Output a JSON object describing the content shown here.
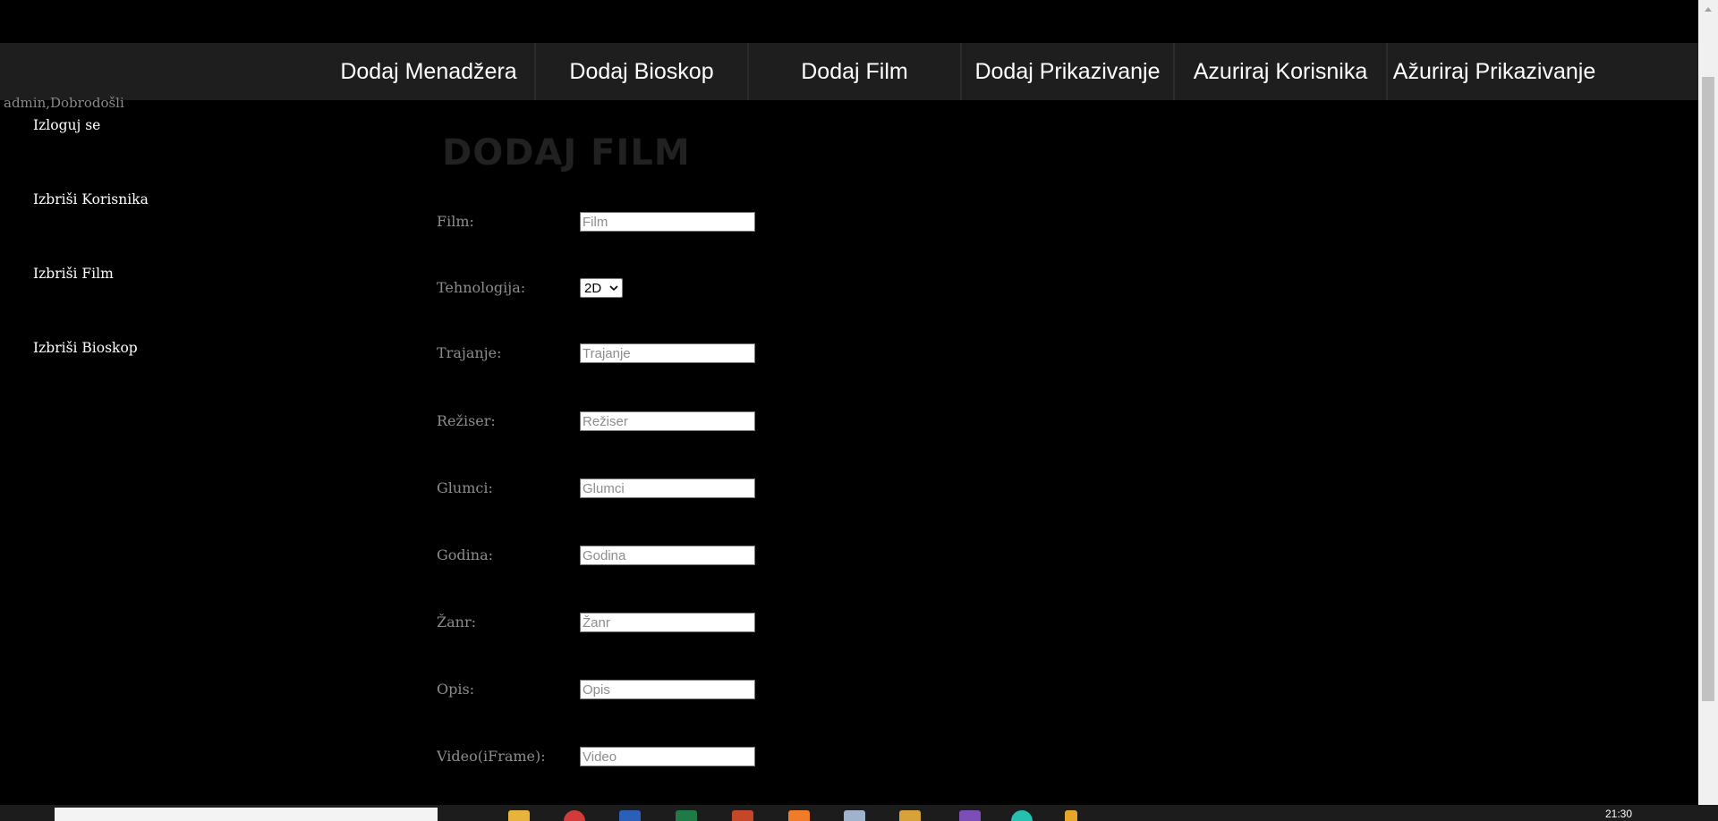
{
  "header": {
    "welcome": "admin,Dobrodošli",
    "nav": [
      {
        "label": "Dodaj Menadžera"
      },
      {
        "label": "Dodaj Bioskop"
      },
      {
        "label": "Dodaj Film"
      },
      {
        "label": "Dodaj Prikazivanje"
      },
      {
        "label": "Azuriraj Korisnika"
      },
      {
        "label": "Ažuriraj Prikazivanje"
      }
    ]
  },
  "sidebar": {
    "items": [
      {
        "label": "Izloguj se"
      },
      {
        "label": "Izbriši Korisnika"
      },
      {
        "label": "Izbriši Film"
      },
      {
        "label": "Izbriši Bioskop"
      }
    ]
  },
  "main": {
    "title": "DODAJ FILM",
    "form": {
      "film": {
        "label": "Film:",
        "placeholder": "Film",
        "value": ""
      },
      "tehnologija": {
        "label": "Tehnologija:",
        "selected": "2D"
      },
      "trajanje": {
        "label": "Trajanje:",
        "placeholder": "Trajanje",
        "value": ""
      },
      "reziser": {
        "label": "Režiser:",
        "placeholder": "Režiser",
        "value": ""
      },
      "glumci": {
        "label": "Glumci:",
        "placeholder": "Glumci",
        "value": ""
      },
      "godina": {
        "label": "Godina:",
        "placeholder": "Godina",
        "value": ""
      },
      "zanr": {
        "label": "Žanr:",
        "placeholder": "Žanr",
        "value": ""
      },
      "opis": {
        "label": "Opis:",
        "placeholder": "Opis",
        "value": ""
      },
      "video": {
        "label": "Video(iFrame):",
        "placeholder": "Video",
        "value": ""
      }
    }
  },
  "taskbar": {
    "clock": "21:30",
    "icons": [
      "file-explorer-icon",
      "browser-icon",
      "word-icon",
      "excel-icon",
      "powerpoint-icon",
      "app-icon",
      "security-icon",
      "folder-app-icon",
      "visual-studio-icon",
      "edge-icon",
      "misc-app-icon"
    ]
  },
  "colors": {
    "background": "#000000",
    "topbar": "#1e1e1e",
    "title": "#212121",
    "label": "#8c8c8c"
  }
}
